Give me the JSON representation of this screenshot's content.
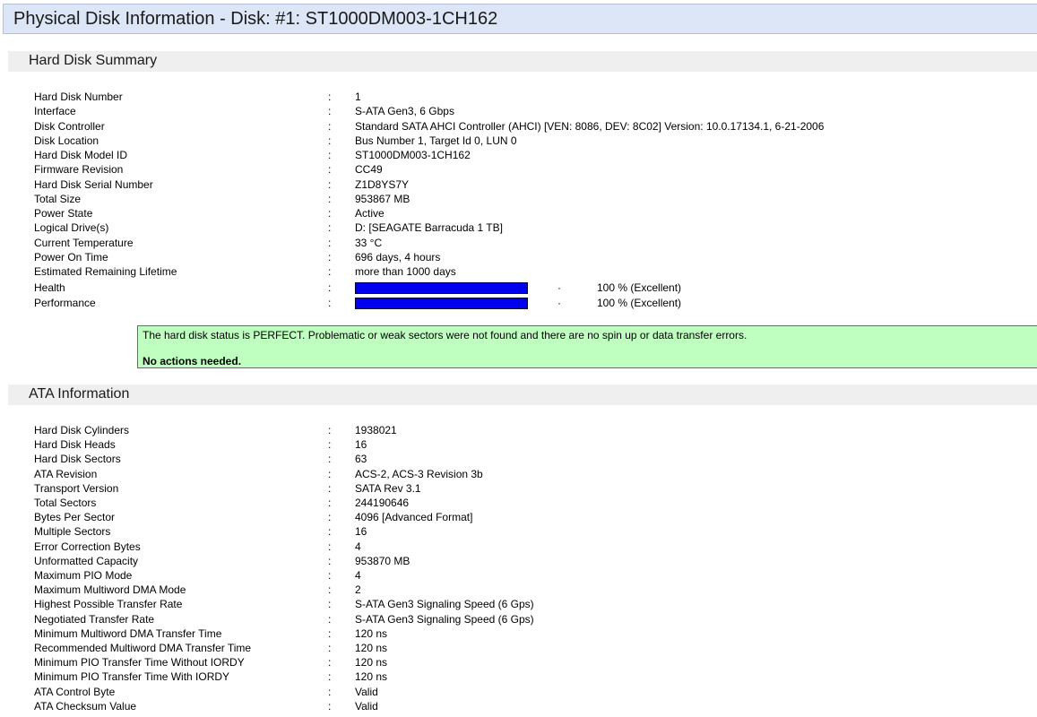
{
  "title": "Physical Disk Information - Disk: #1: ST1000DM003-1CH162",
  "summary": {
    "header": "Hard Disk Summary",
    "rows": [
      {
        "label": "Hard Disk Number",
        "value": "1"
      },
      {
        "label": "Interface",
        "value": "S-ATA Gen3, 6 Gbps"
      },
      {
        "label": "Disk Controller",
        "value": "Standard SATA AHCI Controller (AHCI) [VEN: 8086, DEV: 8C02] Version: 10.0.17134.1, 6-21-2006"
      },
      {
        "label": "Disk Location",
        "value": "Bus Number 1, Target Id 0, LUN 0"
      },
      {
        "label": "Hard Disk Model ID",
        "value": "ST1000DM003-1CH162"
      },
      {
        "label": "Firmware Revision",
        "value": "CC49"
      },
      {
        "label": "Hard Disk Serial Number",
        "value": "Z1D8YS7Y"
      },
      {
        "label": "Total Size",
        "value": "953867 MB"
      },
      {
        "label": "Power State",
        "value": "Active"
      },
      {
        "label": "Logical Drive(s)",
        "value": "D: [SEAGATE Barracuda 1 TB]"
      },
      {
        "label": "Current Temperature",
        "value": "33 °C"
      },
      {
        "label": "Power On Time",
        "value": "696 days, 4 hours"
      },
      {
        "label": "Estimated Remaining Lifetime",
        "value": "more than 1000 days"
      }
    ],
    "health": {
      "label": "Health",
      "percent": 100,
      "text": "100 % (Excellent)"
    },
    "performance": {
      "label": "Performance",
      "percent": 100,
      "text": "100 % (Excellent)"
    },
    "colon": ":",
    "dot": "·",
    "bar_color": "#0000ee",
    "status_message": "The hard disk status is PERFECT. Problematic or weak sectors were not found and there are no spin up or data transfer errors.",
    "status_action": "No actions needed.",
    "status_color": "#bfffbf"
  },
  "ata": {
    "header": "ATA Information",
    "rows": [
      {
        "label": "Hard Disk Cylinders",
        "value": "1938021"
      },
      {
        "label": "Hard Disk Heads",
        "value": "16"
      },
      {
        "label": "Hard Disk Sectors",
        "value": "63"
      },
      {
        "label": "ATA Revision",
        "value": "ACS-2, ACS-3 Revision 3b"
      },
      {
        "label": "Transport Version",
        "value": "SATA Rev 3.1"
      },
      {
        "label": "Total Sectors",
        "value": "244190646"
      },
      {
        "label": "Bytes Per Sector",
        "value": "4096 [Advanced Format]"
      },
      {
        "label": "Multiple Sectors",
        "value": "16"
      },
      {
        "label": "Error Correction Bytes",
        "value": "4"
      },
      {
        "label": "Unformatted Capacity",
        "value": "953870 MB"
      },
      {
        "label": "Maximum PIO Mode",
        "value": "4"
      },
      {
        "label": "Maximum Multiword DMA Mode",
        "value": "2"
      },
      {
        "label": "Highest Possible Transfer Rate",
        "value": "S-ATA Gen3 Signaling Speed (6 Gps)"
      },
      {
        "label": "Negotiated Transfer Rate",
        "value": "S-ATA Gen3 Signaling Speed (6 Gps)"
      },
      {
        "label": "Minimum Multiword DMA Transfer Time",
        "value": "120 ns"
      },
      {
        "label": "Recommended Multiword DMA Transfer Time",
        "value": "120 ns"
      },
      {
        "label": "Minimum PIO Transfer Time Without IORDY",
        "value": "120 ns"
      },
      {
        "label": "Minimum PIO Transfer Time With IORDY",
        "value": "120 ns"
      },
      {
        "label": "ATA Control Byte",
        "value": "Valid"
      },
      {
        "label": "ATA Checksum Value",
        "value": "Valid"
      }
    ]
  }
}
